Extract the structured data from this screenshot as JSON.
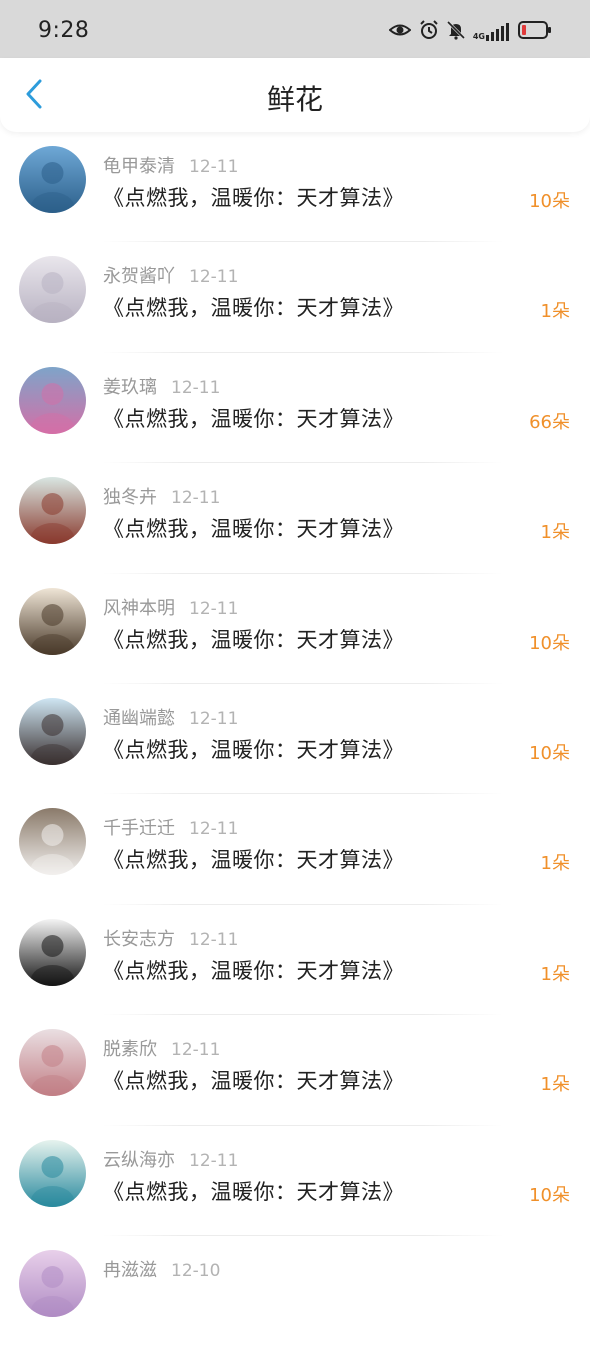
{
  "status_bar": {
    "time": "9:28",
    "network": "4G",
    "icons": [
      "eye-icon",
      "alarm-icon",
      "bell-muted-icon",
      "signal-icon",
      "battery-icon"
    ]
  },
  "header": {
    "title": "鲜花",
    "back_icon": "chevron-left-icon",
    "accent": "#2d9cdb"
  },
  "accent_count_color": "#f0902a",
  "items": [
    {
      "name": "龟甲泰清",
      "date": "12-11",
      "message": "《点燃我，温暖你：天才算法》",
      "count": "10朵",
      "avatar_colors": [
        "#6fa8d6",
        "#2c5f8a"
      ]
    },
    {
      "name": "永贺酱吖",
      "date": "12-11",
      "message": "《点燃我，温暖你：天才算法》",
      "count": "1朵",
      "avatar_colors": [
        "#e9e6ec",
        "#b8b2c2"
      ]
    },
    {
      "name": "姜玖璃",
      "date": "12-11",
      "message": "《点燃我，温暖你：天才算法》",
      "count": "66朵",
      "avatar_colors": [
        "#7ea4c9",
        "#d46fa7"
      ]
    },
    {
      "name": "独冬卉",
      "date": "12-11",
      "message": "《点燃我，温暖你：天才算法》",
      "count": "1朵",
      "avatar_colors": [
        "#d9e6e2",
        "#8a3a2e"
      ]
    },
    {
      "name": "风神本明",
      "date": "12-11",
      "message": "《点燃我，温暖你：天才算法》",
      "count": "10朵",
      "avatar_colors": [
        "#efe5d6",
        "#4a3a2a"
      ]
    },
    {
      "name": "通幽端懿",
      "date": "12-11",
      "message": "《点燃我，温暖你：天才算法》",
      "count": "10朵",
      "avatar_colors": [
        "#cfe6f3",
        "#3a3030"
      ]
    },
    {
      "name": "千手迁迁",
      "date": "12-11",
      "message": "《点燃我，温暖你：天才算法》",
      "count": "1朵",
      "avatar_colors": [
        "#8a7a6a",
        "#f2f0ee"
      ]
    },
    {
      "name": "长安志方",
      "date": "12-11",
      "message": "《点燃我，温暖你：天才算法》",
      "count": "1朵",
      "avatar_colors": [
        "#f4f4f4",
        "#151515"
      ]
    },
    {
      "name": "脱素欣",
      "date": "12-11",
      "message": "《点燃我，温暖你：天才算法》",
      "count": "1朵",
      "avatar_colors": [
        "#eadfe2",
        "#c27f86"
      ]
    },
    {
      "name": "云纵海亦",
      "date": "12-11",
      "message": "《点燃我，温暖你：天才算法》",
      "count": "10朵",
      "avatar_colors": [
        "#e6f3ee",
        "#2a8a9e"
      ]
    },
    {
      "name": "冉滋滋",
      "date": "12-10",
      "message": "",
      "count": "",
      "avatar_colors": [
        "#e8d0ea",
        "#b08cc4"
      ]
    }
  ]
}
